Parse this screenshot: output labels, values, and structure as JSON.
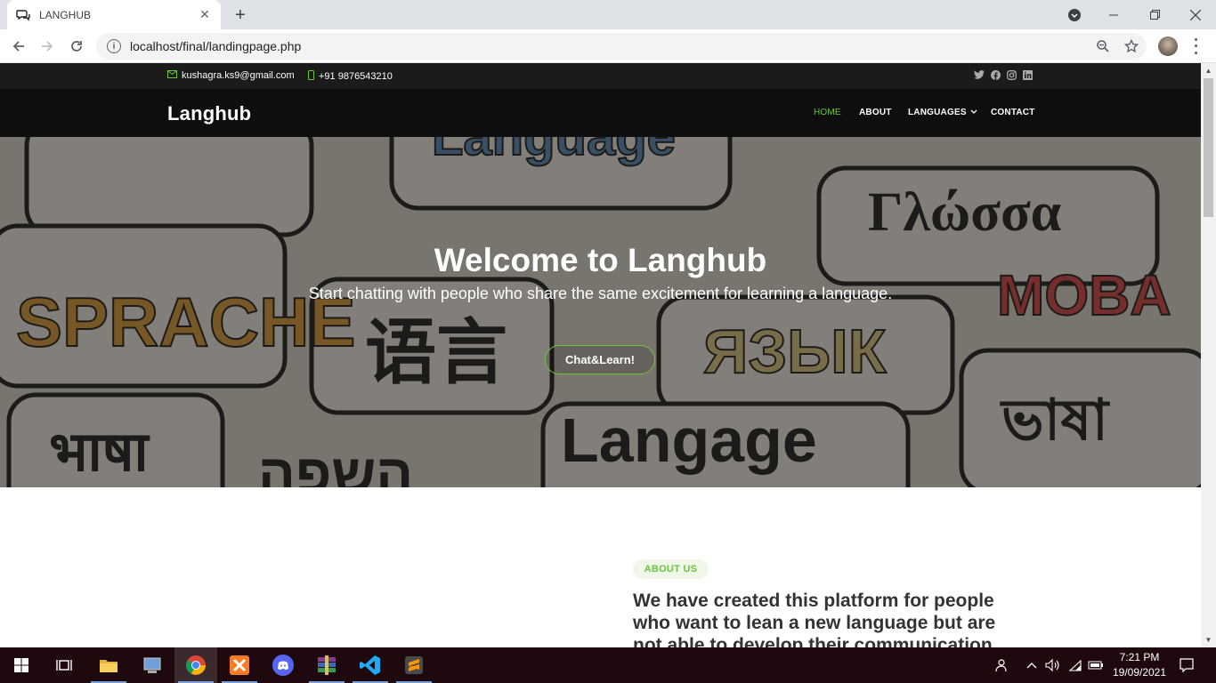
{
  "browser": {
    "tab_title": "LANGHUB",
    "url": "localhost/final/landingpage.php",
    "icons": [
      "chat-favicon-icon",
      "close-icon",
      "plus-icon",
      "back-icon",
      "forward-icon",
      "reload-icon",
      "info-icon",
      "zoom-icon",
      "star-icon",
      "avatar",
      "kebab-menu-icon",
      "tab-search-icon",
      "minimize-icon",
      "maximize-icon",
      "window-close-icon"
    ]
  },
  "topbar": {
    "email": "kushagra.ks9@gmail.com",
    "phone": "+91 9876543210",
    "social_icons": [
      "twitter-icon",
      "facebook-icon",
      "instagram-icon",
      "linkedin-icon"
    ]
  },
  "header": {
    "logo": "Langhub",
    "nav": {
      "home": "HOME",
      "about": "ABOUT",
      "languages": "LANGUAGES",
      "contact": "CONTACT"
    },
    "accent_color": "#6bc53d"
  },
  "hero": {
    "title": "Welcome to Langhub",
    "subtitle": "Start chatting with people who share the same excitement for learning a language.",
    "cta": "Chat&Learn!",
    "background_words": [
      "Language",
      "Γλώσσα",
      "SPRACHE",
      "язык",
      "MOBA",
      "भाषा",
      "השפה",
      "Langage",
      "语言",
      "ভাষা"
    ]
  },
  "about": {
    "badge": "ABOUT US",
    "text": "We have created this platform for people who want to lean a new language but are not able to develop their communication"
  },
  "taskbar": {
    "time": "7:21 PM",
    "date": "19/09/2021"
  }
}
